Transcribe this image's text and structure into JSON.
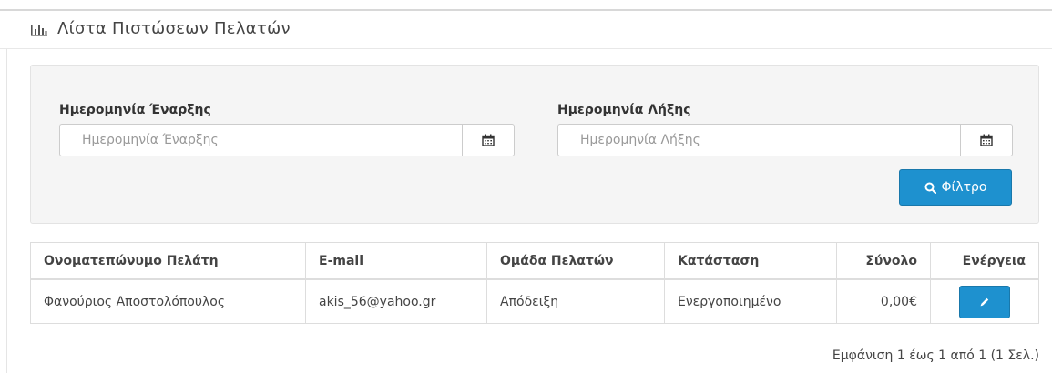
{
  "header": {
    "title": "Λίστα Πιστώσεων Πελατών",
    "icon": "bar-chart-icon"
  },
  "filter": {
    "start_label": "Ημερομηνία Έναρξης",
    "start_placeholder": "Ημερομηνία Έναρξης",
    "end_label": "Ημερομηνία Λήξης",
    "end_placeholder": "Ημερομηνία Λήξης",
    "button_label": "Φίλτρο",
    "calendar_icon": "calendar-icon",
    "search_icon": "search-icon"
  },
  "table": {
    "headers": [
      "Ονοματεπώνυμο Πελάτη",
      "E-mail",
      "Ομάδα Πελατών",
      "Κατάσταση",
      "Σύνολο",
      "Ενέργεια"
    ],
    "rows": [
      {
        "name": "Φανούριος Αποστολόπουλος",
        "email": "akis_56@yahoo.gr",
        "group": "Απόδειξη",
        "status": "Ενεργοποιημένο",
        "total": "0,00€",
        "action_icon": "pencil-icon"
      }
    ]
  },
  "pagination": {
    "text": "Εμφάνιση 1 έως 1 από 1 (1 Σελ.)"
  },
  "colors": {
    "primary": "#1e91cf",
    "well_bg": "#f5f5f5"
  }
}
